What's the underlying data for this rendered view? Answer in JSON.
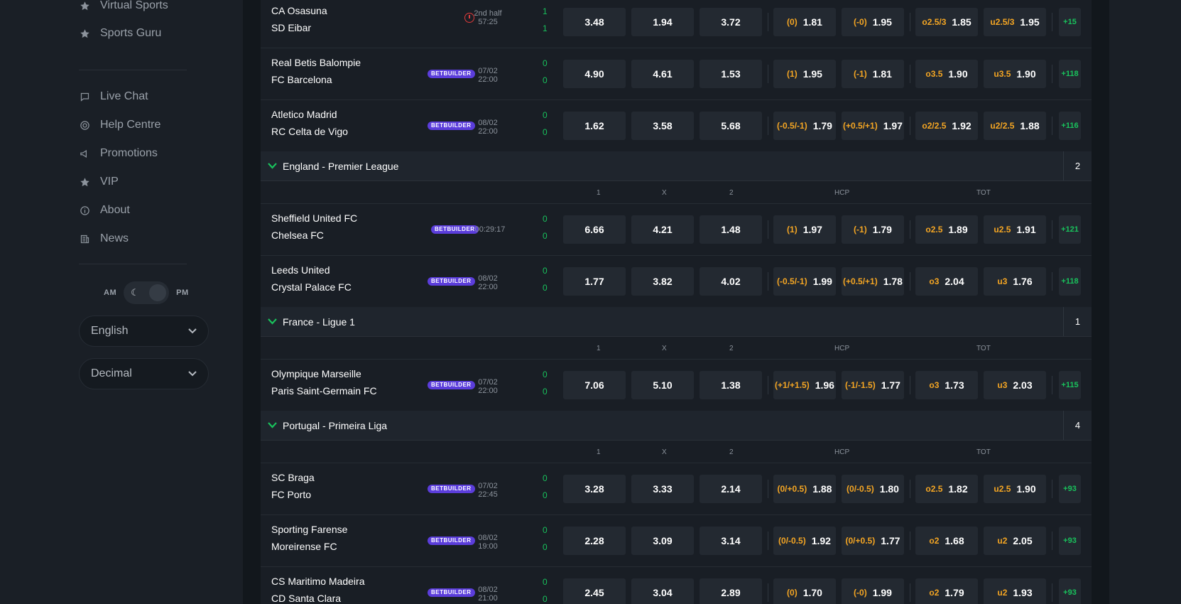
{
  "sidebar": {
    "items": [
      {
        "label": "Virtual Sports",
        "icon": "star-icon"
      },
      {
        "label": "Sports Guru",
        "icon": "star-icon"
      },
      {
        "label": "Live Chat",
        "icon": "chat-icon"
      },
      {
        "label": "Help Centre",
        "icon": "lifebuoy-icon"
      },
      {
        "label": "Promotions",
        "icon": "megaphone-icon"
      },
      {
        "label": "VIP",
        "icon": "star-icon"
      },
      {
        "label": "About",
        "icon": "info-icon"
      },
      {
        "label": "News",
        "icon": "news-icon"
      }
    ],
    "am": "AM",
    "pm": "PM",
    "language": "English",
    "odds_format": "Decimal"
  },
  "headers": {
    "c1": "1",
    "cx": "X",
    "c2": "2",
    "hcp": "HCP",
    "tot": "TOT"
  },
  "badge": "BETBUILDER",
  "leagues": [
    {
      "name": "England - Premier League",
      "count": "2"
    },
    {
      "name": "France - Ligue 1",
      "count": "1"
    },
    {
      "name": "Portugal - Primeira Liga",
      "count": "4"
    }
  ],
  "matches": [
    {
      "home": "CA Osasuna",
      "away": "SD Eibar",
      "time1": "2nd half",
      "time2": "57:25",
      "s1": "1",
      "s2": "1",
      "o1": "3.48",
      "ox": "1.94",
      "o2": "3.72",
      "h1k": "(0)",
      "h1": "1.81",
      "h2k": "(-0)",
      "h2": "1.95",
      "t1k": "o2.5/3",
      "t1": "1.85",
      "t2k": "u2.5/3",
      "t2": "1.95",
      "more": "+15"
    },
    {
      "home": "Real Betis Balompie",
      "away": "FC Barcelona",
      "time1": "07/02",
      "time2": "22:00",
      "s1": "0",
      "s2": "0",
      "o1": "4.90",
      "ox": "4.61",
      "o2": "1.53",
      "h1k": "(1)",
      "h1": "1.95",
      "h2k": "(-1)",
      "h2": "1.81",
      "t1k": "o3.5",
      "t1": "1.90",
      "t2k": "u3.5",
      "t2": "1.90",
      "more": "+118"
    },
    {
      "home": "Atletico Madrid",
      "away": "RC Celta de Vigo",
      "time1": "08/02",
      "time2": "22:00",
      "s1": "0",
      "s2": "0",
      "o1": "1.62",
      "ox": "3.58",
      "o2": "5.68",
      "h1k": "(-0.5/-1)",
      "h1": "1.79",
      "h2k": "(+0.5/+1)",
      "h2": "1.97",
      "t1k": "o2/2.5",
      "t1": "1.92",
      "t2k": "u2/2.5",
      "t2": "1.88",
      "more": "+116"
    },
    {
      "home": "Sheffield United FC",
      "away": "Chelsea FC",
      "time1": "00:29:17",
      "time2": "",
      "s1": "0",
      "s2": "0",
      "o1": "6.66",
      "ox": "4.21",
      "o2": "1.48",
      "h1k": "(1)",
      "h1": "1.97",
      "h2k": "(-1)",
      "h2": "1.79",
      "t1k": "o2.5",
      "t1": "1.89",
      "t2k": "u2.5",
      "t2": "1.91",
      "more": "+121"
    },
    {
      "home": "Leeds United",
      "away": "Crystal Palace FC",
      "time1": "08/02",
      "time2": "22:00",
      "s1": "0",
      "s2": "0",
      "o1": "1.77",
      "ox": "3.82",
      "o2": "4.02",
      "h1k": "(-0.5/-1)",
      "h1": "1.99",
      "h2k": "(+0.5/+1)",
      "h2": "1.78",
      "t1k": "o3",
      "t1": "2.04",
      "t2k": "u3",
      "t2": "1.76",
      "more": "+118"
    },
    {
      "home": "Olympique Marseille",
      "away": "Paris Saint-Germain FC",
      "time1": "07/02",
      "time2": "22:00",
      "s1": "0",
      "s2": "0",
      "o1": "7.06",
      "ox": "5.10",
      "o2": "1.38",
      "h1k": "(+1/+1.5)",
      "h1": "1.96",
      "h2k": "(-1/-1.5)",
      "h2": "1.77",
      "t1k": "o3",
      "t1": "1.73",
      "t2k": "u3",
      "t2": "2.03",
      "more": "+115"
    },
    {
      "home": "SC Braga",
      "away": "FC Porto",
      "time1": "07/02",
      "time2": "22:45",
      "s1": "0",
      "s2": "0",
      "o1": "3.28",
      "ox": "3.33",
      "o2": "2.14",
      "h1k": "(0/+0.5)",
      "h1": "1.88",
      "h2k": "(0/-0.5)",
      "h2": "1.80",
      "t1k": "o2.5",
      "t1": "1.82",
      "t2k": "u2.5",
      "t2": "1.90",
      "more": "+93"
    },
    {
      "home": "Sporting Farense",
      "away": "Moreirense FC",
      "time1": "08/02",
      "time2": "19:00",
      "s1": "0",
      "s2": "0",
      "o1": "2.28",
      "ox": "3.09",
      "o2": "3.14",
      "h1k": "(0/-0.5)",
      "h1": "1.92",
      "h2k": "(0/+0.5)",
      "h2": "1.77",
      "t1k": "o2",
      "t1": "1.68",
      "t2k": "u2",
      "t2": "2.05",
      "more": "+93"
    },
    {
      "home": "CS Maritimo Madeira",
      "away": "CD Santa Clara",
      "time1": "08/02",
      "time2": "21:00",
      "s1": "0",
      "s2": "0",
      "o1": "2.45",
      "ox": "3.04",
      "o2": "2.89",
      "h1k": "(0)",
      "h1": "1.70",
      "h2k": "(-0)",
      "h2": "1.99",
      "t1k": "o2",
      "t1": "1.79",
      "t2k": "u2",
      "t2": "1.93",
      "more": "+93"
    }
  ]
}
